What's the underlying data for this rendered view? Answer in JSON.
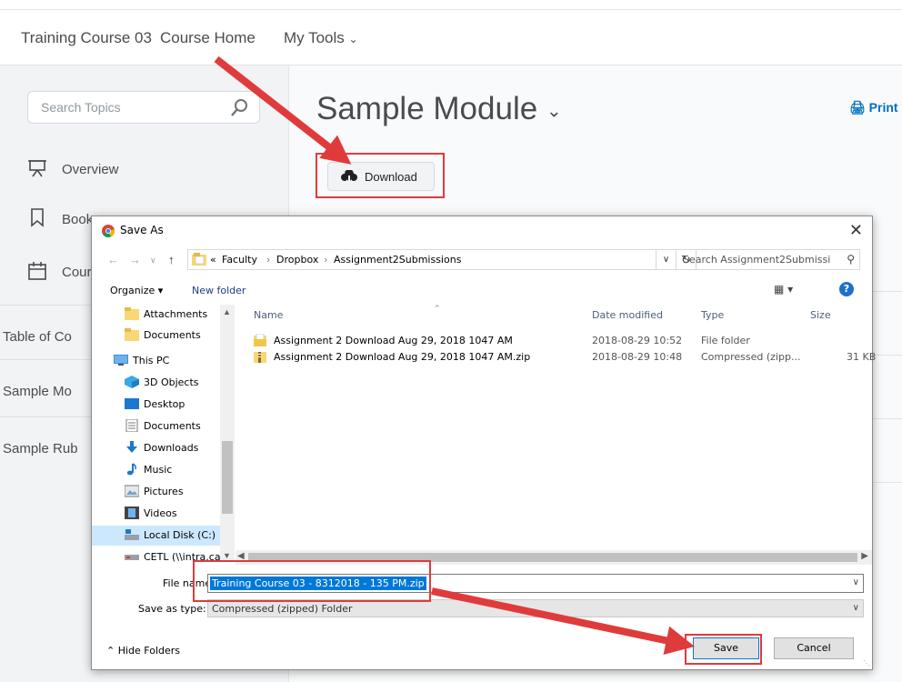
{
  "colors": {
    "annotation_red": "#e03b3b",
    "selection_blue": "#0078d7",
    "link_blue": "#006fbf"
  },
  "lms": {
    "nav": [
      "Training Course 03",
      "Course Home",
      "My Tools"
    ],
    "search_placeholder": "Search Topics",
    "sidebar": {
      "overview": "Overview",
      "bookmarks": "Book",
      "course_schedule": "Cours",
      "table_of_contents": "Table of Co",
      "sample_module": "Sample Mo",
      "sample_rubric": "Sample Rub"
    },
    "module_title": "Sample Module",
    "print_label": "Print",
    "download_label": "Download"
  },
  "dialog": {
    "title": "Save As",
    "breadcrumb": [
      "«",
      "Faculty",
      "Dropbox",
      "Assignment2Submissions"
    ],
    "search_placeholder": "Search Assignment2Submissi",
    "toolbar": {
      "organize": "Organize ▾",
      "new_folder": "New folder"
    },
    "tree": [
      {
        "label": "Attachments",
        "icon": "folder-icon"
      },
      {
        "label": "Documents",
        "icon": "folder-icon"
      },
      {
        "label": "This PC",
        "icon": "pc-icon"
      },
      {
        "label": "3D Objects",
        "icon": "3d-objects-icon"
      },
      {
        "label": "Desktop",
        "icon": "desktop-icon"
      },
      {
        "label": "Documents",
        "icon": "documents-icon"
      },
      {
        "label": "Downloads",
        "icon": "downloads-icon"
      },
      {
        "label": "Music",
        "icon": "music-icon"
      },
      {
        "label": "Pictures",
        "icon": "pictures-icon"
      },
      {
        "label": "Videos",
        "icon": "videos-icon"
      },
      {
        "label": "Local Disk (C:)",
        "icon": "disk-icon"
      },
      {
        "label": "CETL (\\\\intra.car",
        "icon": "network-drive-icon"
      }
    ],
    "columns": [
      "Name",
      "Date modified",
      "Type",
      "Size"
    ],
    "files": [
      {
        "name": "Assignment 2 Download Aug 29, 2018 1047 AM",
        "date": "2018-08-29 10:52",
        "type": "File folder",
        "size": ""
      },
      {
        "name": "Assignment 2 Download Aug 29, 2018 1047 AM.zip",
        "date": "2018-08-29 10:48",
        "type": "Compressed (zipp...",
        "size": "31 KB"
      }
    ],
    "file_name_label": "File name:",
    "file_name_value": "Training Course 03 - 8312018 - 135 PM.zip",
    "save_type_label": "Save as type:",
    "save_type_value": "Compressed (zipped) Folder",
    "hide_folders": "Hide Folders",
    "save_button": "Save",
    "cancel_button": "Cancel"
  }
}
